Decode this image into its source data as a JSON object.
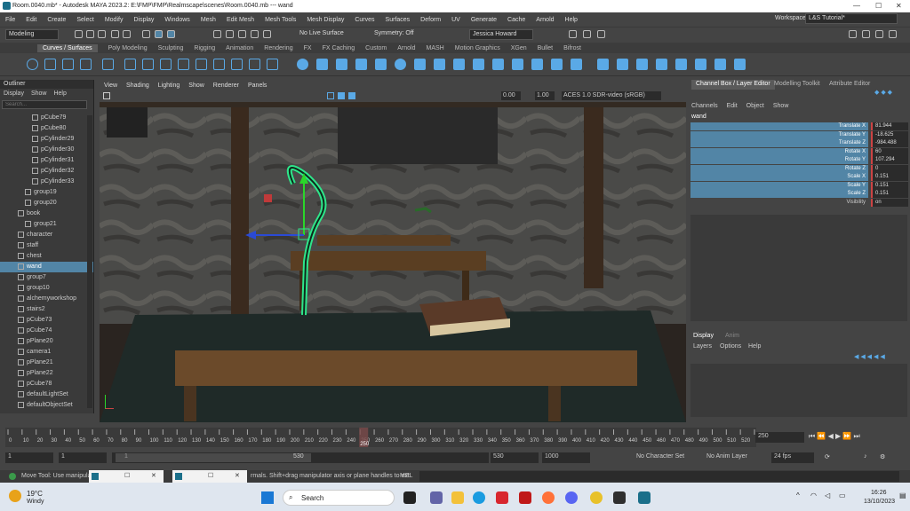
{
  "titlebar": {
    "title": "Room.0040.mb* - Autodesk MAYA 2023.2: E:\\FMP\\FMP\\Realmscape\\scenes\\Room.0040.mb   ---   wand"
  },
  "menubar": {
    "items": [
      "File",
      "Edit",
      "Create",
      "Select",
      "Modify",
      "Display",
      "Windows",
      "Mesh",
      "Edit Mesh",
      "Mesh Tools",
      "Mesh Display",
      "Curves",
      "Surfaces",
      "Deform",
      "UV",
      "Generate",
      "Cache",
      "Arnold",
      "Help"
    ],
    "workspace_label": "Workspace:",
    "workspace_value": "L&S Tutorial*"
  },
  "statusline": {
    "mode": "Modeling",
    "live": "No Live Surface",
    "symmetry": "Symmetry: Off",
    "user": "Jessica Howard"
  },
  "shelf": {
    "tabs": [
      "Curves / Surfaces",
      "Poly Modeling",
      "Sculpting",
      "Rigging",
      "Animation",
      "Rendering",
      "FX",
      "FX Caching",
      "Custom",
      "Arnold",
      "MASH",
      "Motion Graphics",
      "XGen",
      "Bullet",
      "Bifrost"
    ],
    "active": 0
  },
  "outliner": {
    "title": "Outliner",
    "menu": [
      "Display",
      "Show",
      "Help"
    ],
    "search_placeholder": "Search...",
    "items": [
      {
        "label": "pCube79",
        "indent": 2
      },
      {
        "label": "pCube80",
        "indent": 2
      },
      {
        "label": "pCylinder29",
        "indent": 2
      },
      {
        "label": "pCylinder30",
        "indent": 2
      },
      {
        "label": "pCylinder31",
        "indent": 2
      },
      {
        "label": "pCylinder32",
        "indent": 2
      },
      {
        "label": "pCylinder33",
        "indent": 2
      },
      {
        "label": "group19",
        "indent": 1
      },
      {
        "label": "group20",
        "indent": 1
      },
      {
        "label": "book",
        "indent": 0
      },
      {
        "label": "group21",
        "indent": 1
      },
      {
        "label": "character",
        "indent": 0
      },
      {
        "label": "staff",
        "indent": 0
      },
      {
        "label": "chest",
        "indent": 0
      },
      {
        "label": "wand",
        "indent": 0,
        "selected": true
      },
      {
        "label": "group7",
        "indent": 0
      },
      {
        "label": "group10",
        "indent": 0
      },
      {
        "label": "alchemyworkshop",
        "indent": 0
      },
      {
        "label": "stairs2",
        "indent": 0
      },
      {
        "label": "pCube73",
        "indent": 0
      },
      {
        "label": "pCube74",
        "indent": 0
      },
      {
        "label": "pPlane20",
        "indent": 0
      },
      {
        "label": "camera1",
        "indent": 0
      },
      {
        "label": "pPlane21",
        "indent": 0
      },
      {
        "label": "pPlane22",
        "indent": 0
      },
      {
        "label": "pCube78",
        "indent": 0
      },
      {
        "label": "defaultLightSet",
        "indent": 0
      },
      {
        "label": "defaultObjectSet",
        "indent": 0
      }
    ]
  },
  "viewport": {
    "menu": [
      "View",
      "Shading",
      "Lighting",
      "Show",
      "Renderer",
      "Panels"
    ],
    "exposure": "0.00",
    "gamma": "1.00",
    "colorspace": "ACES 1.0 SDR-video (sRGB)"
  },
  "channelbox": {
    "tabs": [
      "Channel Box / Layer Editor",
      "Modelling Toolkit",
      "Attribute Editor"
    ],
    "menu": [
      "Channels",
      "Edit",
      "Object",
      "Show"
    ],
    "object": "wand",
    "attrs": [
      {
        "name": "Translate X",
        "value": "81.944"
      },
      {
        "name": "Translate Y",
        "value": "-18.625"
      },
      {
        "name": "Translate Z",
        "value": "-984.488"
      },
      {
        "name": "Rotate X",
        "value": "60"
      },
      {
        "name": "Rotate Y",
        "value": "107.294"
      },
      {
        "name": "Rotate Z",
        "value": "0"
      },
      {
        "name": "Scale X",
        "value": "0.151"
      },
      {
        "name": "Scale Y",
        "value": "0.151"
      },
      {
        "name": "Scale Z",
        "value": "0.151"
      },
      {
        "name": "Visibility",
        "value": "on"
      }
    ],
    "layer_tabs": [
      "Display",
      "Anim"
    ],
    "layer_menu": [
      "Layers",
      "Options",
      "Help"
    ]
  },
  "timeline": {
    "ticks": [
      "0",
      "10",
      "20",
      "30",
      "40",
      "50",
      "60",
      "70",
      "80",
      "90",
      "100",
      "110",
      "120",
      "130",
      "140",
      "150",
      "160",
      "170",
      "180",
      "190",
      "200",
      "210",
      "220",
      "230",
      "240",
      "250",
      "260",
      "270",
      "280",
      "290",
      "300",
      "310",
      "320",
      "330",
      "340",
      "350",
      "360",
      "370",
      "380",
      "390",
      "400",
      "410",
      "420",
      "430",
      "440",
      "450",
      "460",
      "470",
      "480",
      "490",
      "500",
      "510",
      "520",
      "530"
    ],
    "current": "250",
    "current_field": "250"
  },
  "range": {
    "start": "1",
    "start2": "1",
    "slider_start": "1",
    "slider_end": "530",
    "end": "530",
    "end2": "1000",
    "char_set": "No Character Set",
    "anim_layer": "No Anim Layer",
    "fps": "24 fps"
  },
  "helpline": {
    "text": "Move Tool: Use manipulator",
    "text2": "rmals. Shift+drag manipulator axis or plane handles to ext",
    "mel": "MEL"
  },
  "taskbar": {
    "temp": "19°C",
    "weather": "Windy",
    "search": "Search",
    "time": "16:26",
    "date": "13/10/2023"
  }
}
